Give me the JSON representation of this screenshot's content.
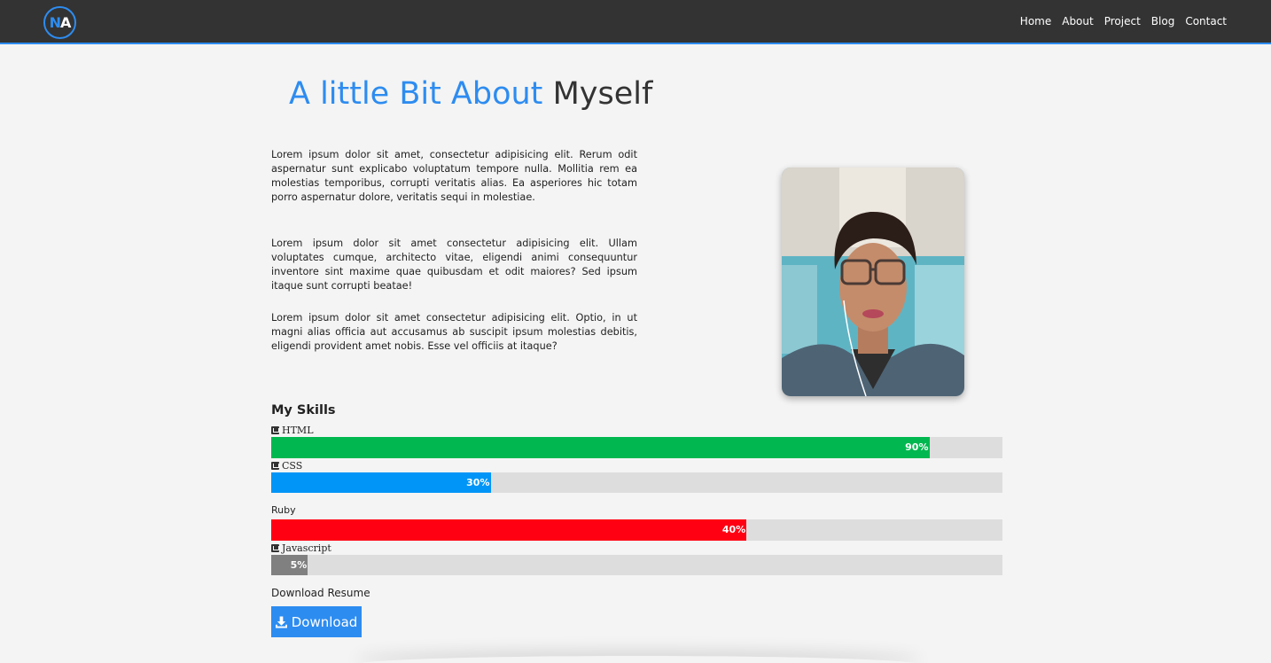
{
  "nav": {
    "logo_n": "N",
    "logo_a": "A",
    "links": [
      "Home",
      "About",
      "Project",
      "Blog",
      "Contact"
    ]
  },
  "about": {
    "title_blue": "A little Bit About",
    "title_dark": "Myself",
    "paragraphs": [
      "Lorem ipsum dolor sit amet, consectetur adipisicing elit. Rerum odit aspernatur sunt explicabo voluptatum tempore nulla. Mollitia rem ea molestias temporibus, corrupti veritatis alias. Ea asperiores hic totam porro aspernatur dolore, veritatis sequi in molestiae.",
      "Lorem ipsum dolor sit amet consectetur adipisicing elit. Ullam voluptates cumque, architecto vitae, eligendi animi consequuntur inventore sint maxime quae quibusdam et odit maiores? Sed ipsum itaque sunt corrupti beatae!",
      "Lorem ipsum dolor sit amet consectetur adipisicing elit. Optio, in ut magni alias officia aut accusamus ab suscipit ipsum molestias debitis, eligendi provident amet nobis. Esse vel officiis at itaque?"
    ]
  },
  "skills": {
    "title": "My Skills",
    "items": [
      {
        "name": "HTML",
        "icon": "html5-icon",
        "percent": 90,
        "label": "90%",
        "color": "#00b84f"
      },
      {
        "name": "CSS",
        "icon": "css3-icon",
        "percent": 30,
        "label": "30%",
        "color": "#0095f7"
      },
      {
        "name": "Ruby",
        "icon": "",
        "percent": 65,
        "label": "40%",
        "color": "#ff0013"
      },
      {
        "name": "Javascript",
        "icon": "js-icon",
        "percent": 5,
        "label": "5%",
        "color": "#808080"
      }
    ]
  },
  "resume": {
    "label": "Download Resume",
    "button": "Download"
  },
  "colors": {
    "accent": "#2d8cf0",
    "navbar": "#333333",
    "track": "#dddddd"
  }
}
